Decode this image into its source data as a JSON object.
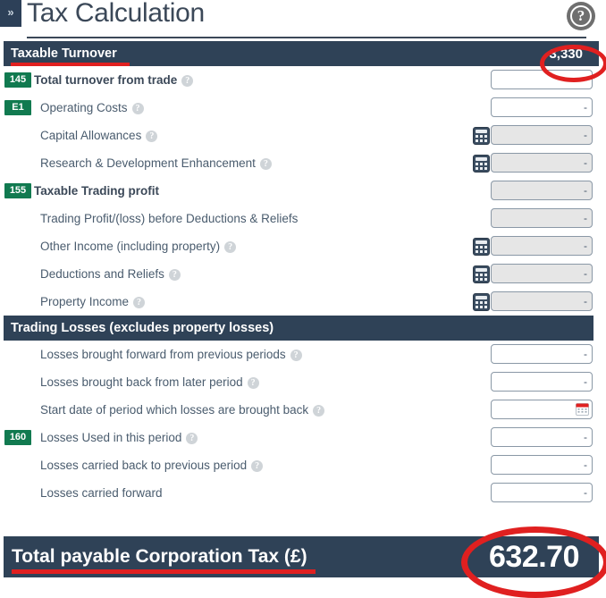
{
  "header": {
    "sidebar_toggle": "»",
    "title": "Tax Calculation",
    "help_icon": "help-circle-icon",
    "help_glyph": "?"
  },
  "sections": [
    {
      "name": "taxable-turnover",
      "label": "Taxable Turnover",
      "value": "3,330",
      "rows": [
        {
          "name": "total-turnover-from-trade",
          "badge": "145",
          "label": "Total turnover from trade",
          "help": true,
          "bold": true,
          "calc": false,
          "readonly": false,
          "value": "-"
        },
        {
          "name": "operating-costs",
          "badge": "E1",
          "label": "Operating Costs",
          "help": true,
          "bold": false,
          "calc": false,
          "readonly": false,
          "value": "-"
        },
        {
          "name": "capital-allowances",
          "badge": "",
          "label": "Capital Allowances",
          "help": true,
          "bold": false,
          "calc": true,
          "readonly": true,
          "value": "-"
        },
        {
          "name": "research-development-enhancement",
          "badge": "",
          "label": "Research & Development Enhancement",
          "help": true,
          "bold": false,
          "calc": true,
          "readonly": true,
          "value": "-"
        },
        {
          "name": "taxable-trading-profit",
          "badge": "155",
          "label": "Taxable Trading profit",
          "help": false,
          "bold": true,
          "calc": false,
          "readonly": true,
          "value": "-"
        },
        {
          "name": "trading-profit-loss-before-deductions-reliefs",
          "badge": "",
          "label": "Trading Profit/(loss) before Deductions & Reliefs",
          "help": false,
          "bold": false,
          "calc": false,
          "readonly": true,
          "value": "-"
        },
        {
          "name": "other-income-including-property",
          "badge": "",
          "label": "Other Income (including property)",
          "help": true,
          "bold": false,
          "calc": true,
          "readonly": true,
          "value": "-"
        },
        {
          "name": "deductions-and-reliefs",
          "badge": "",
          "label": "Deductions and Reliefs",
          "help": true,
          "bold": false,
          "calc": true,
          "readonly": true,
          "value": "-"
        },
        {
          "name": "property-income",
          "badge": "",
          "label": "Property Income",
          "help": true,
          "bold": false,
          "calc": true,
          "readonly": true,
          "value": "-"
        }
      ]
    },
    {
      "name": "trading-losses",
      "label": "Trading Losses (excludes property losses)",
      "value": "",
      "rows": [
        {
          "name": "losses-brought-forward-from-previous-periods",
          "badge": "",
          "label": "Losses brought forward from previous periods",
          "help": true,
          "bold": false,
          "calc": false,
          "readonly": false,
          "value": "-"
        },
        {
          "name": "losses-brought-back-from-later-period",
          "badge": "",
          "label": "Losses brought back from later period",
          "help": true,
          "bold": false,
          "calc": false,
          "readonly": false,
          "value": "-"
        },
        {
          "name": "start-date-of-period-which-losses-are-brought-back",
          "badge": "",
          "label": "Start date of period which losses are brought back",
          "help": true,
          "bold": false,
          "calc": false,
          "readonly": false,
          "value": "",
          "datepicker": true
        },
        {
          "name": "losses-used-in-this-period",
          "badge": "160",
          "label": "Losses Used in this period",
          "help": true,
          "bold": false,
          "calc": false,
          "readonly": false,
          "value": "-"
        },
        {
          "name": "losses-carried-back-to-previous-period",
          "badge": "",
          "label": "Losses carried back to previous period",
          "help": true,
          "bold": false,
          "calc": false,
          "readonly": false,
          "value": "-"
        },
        {
          "name": "losses-carried-forward",
          "badge": "",
          "label": "Losses carried forward",
          "help": false,
          "bold": false,
          "calc": false,
          "readonly": false,
          "value": "-"
        }
      ]
    }
  ],
  "total": {
    "label": "Total payable Corporation Tax (£)",
    "value": "632.70"
  },
  "colors": {
    "section_bar": "#2f4257",
    "badge_green": "#117a50",
    "annotation_red": "#e02020",
    "label_text": "#4a5c6e",
    "readonly_field": "#e6e6e6"
  }
}
